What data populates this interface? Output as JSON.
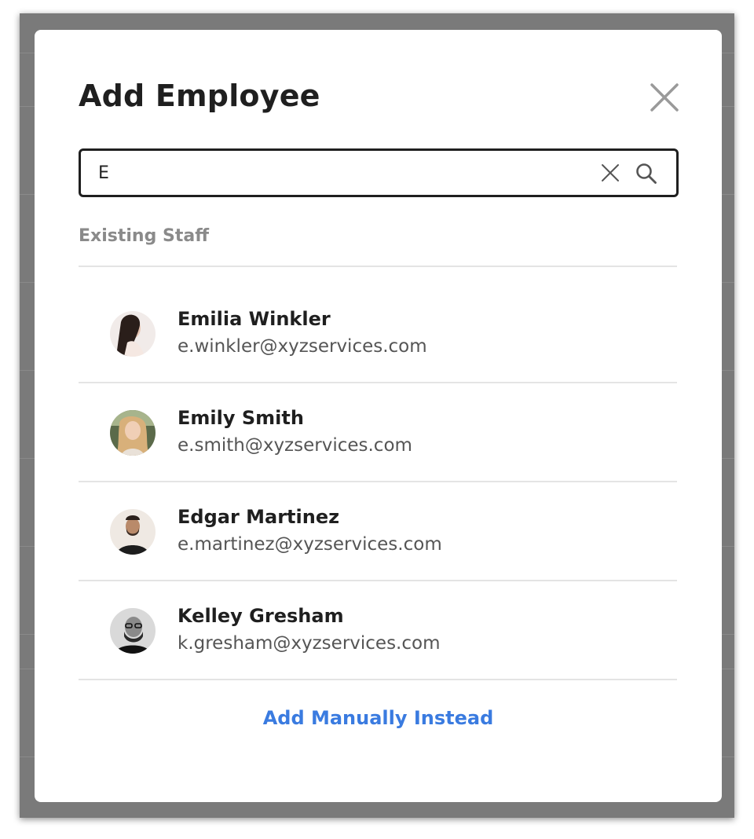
{
  "modal": {
    "title": "Add Employee",
    "close_icon": "close-icon"
  },
  "search": {
    "value": "E",
    "placeholder": "",
    "clear_icon": "clear-icon",
    "search_icon": "search-icon"
  },
  "section": {
    "label": "Existing Staff"
  },
  "staff": [
    {
      "name": "Emilia Winkler",
      "email": "e.winkler@xyzservices.com",
      "avatar_color": "#d9c2b8"
    },
    {
      "name": "Emily Smith",
      "email": "e.smith@xyzservices.com",
      "avatar_color": "#c9a27a"
    },
    {
      "name": "Edgar Martinez",
      "email": "e.martinez@xyzservices.com",
      "avatar_color": "#e8e0d8"
    },
    {
      "name": "Kelley Gresham",
      "email": "k.gresham@xyzservices.com",
      "avatar_color": "#2a2a2a"
    }
  ],
  "actions": {
    "add_manually": "Add Manually Instead"
  },
  "colors": {
    "accent": "#3a7be0",
    "overlay": "#7a7a7a",
    "highlight": "#e6e8ec"
  }
}
